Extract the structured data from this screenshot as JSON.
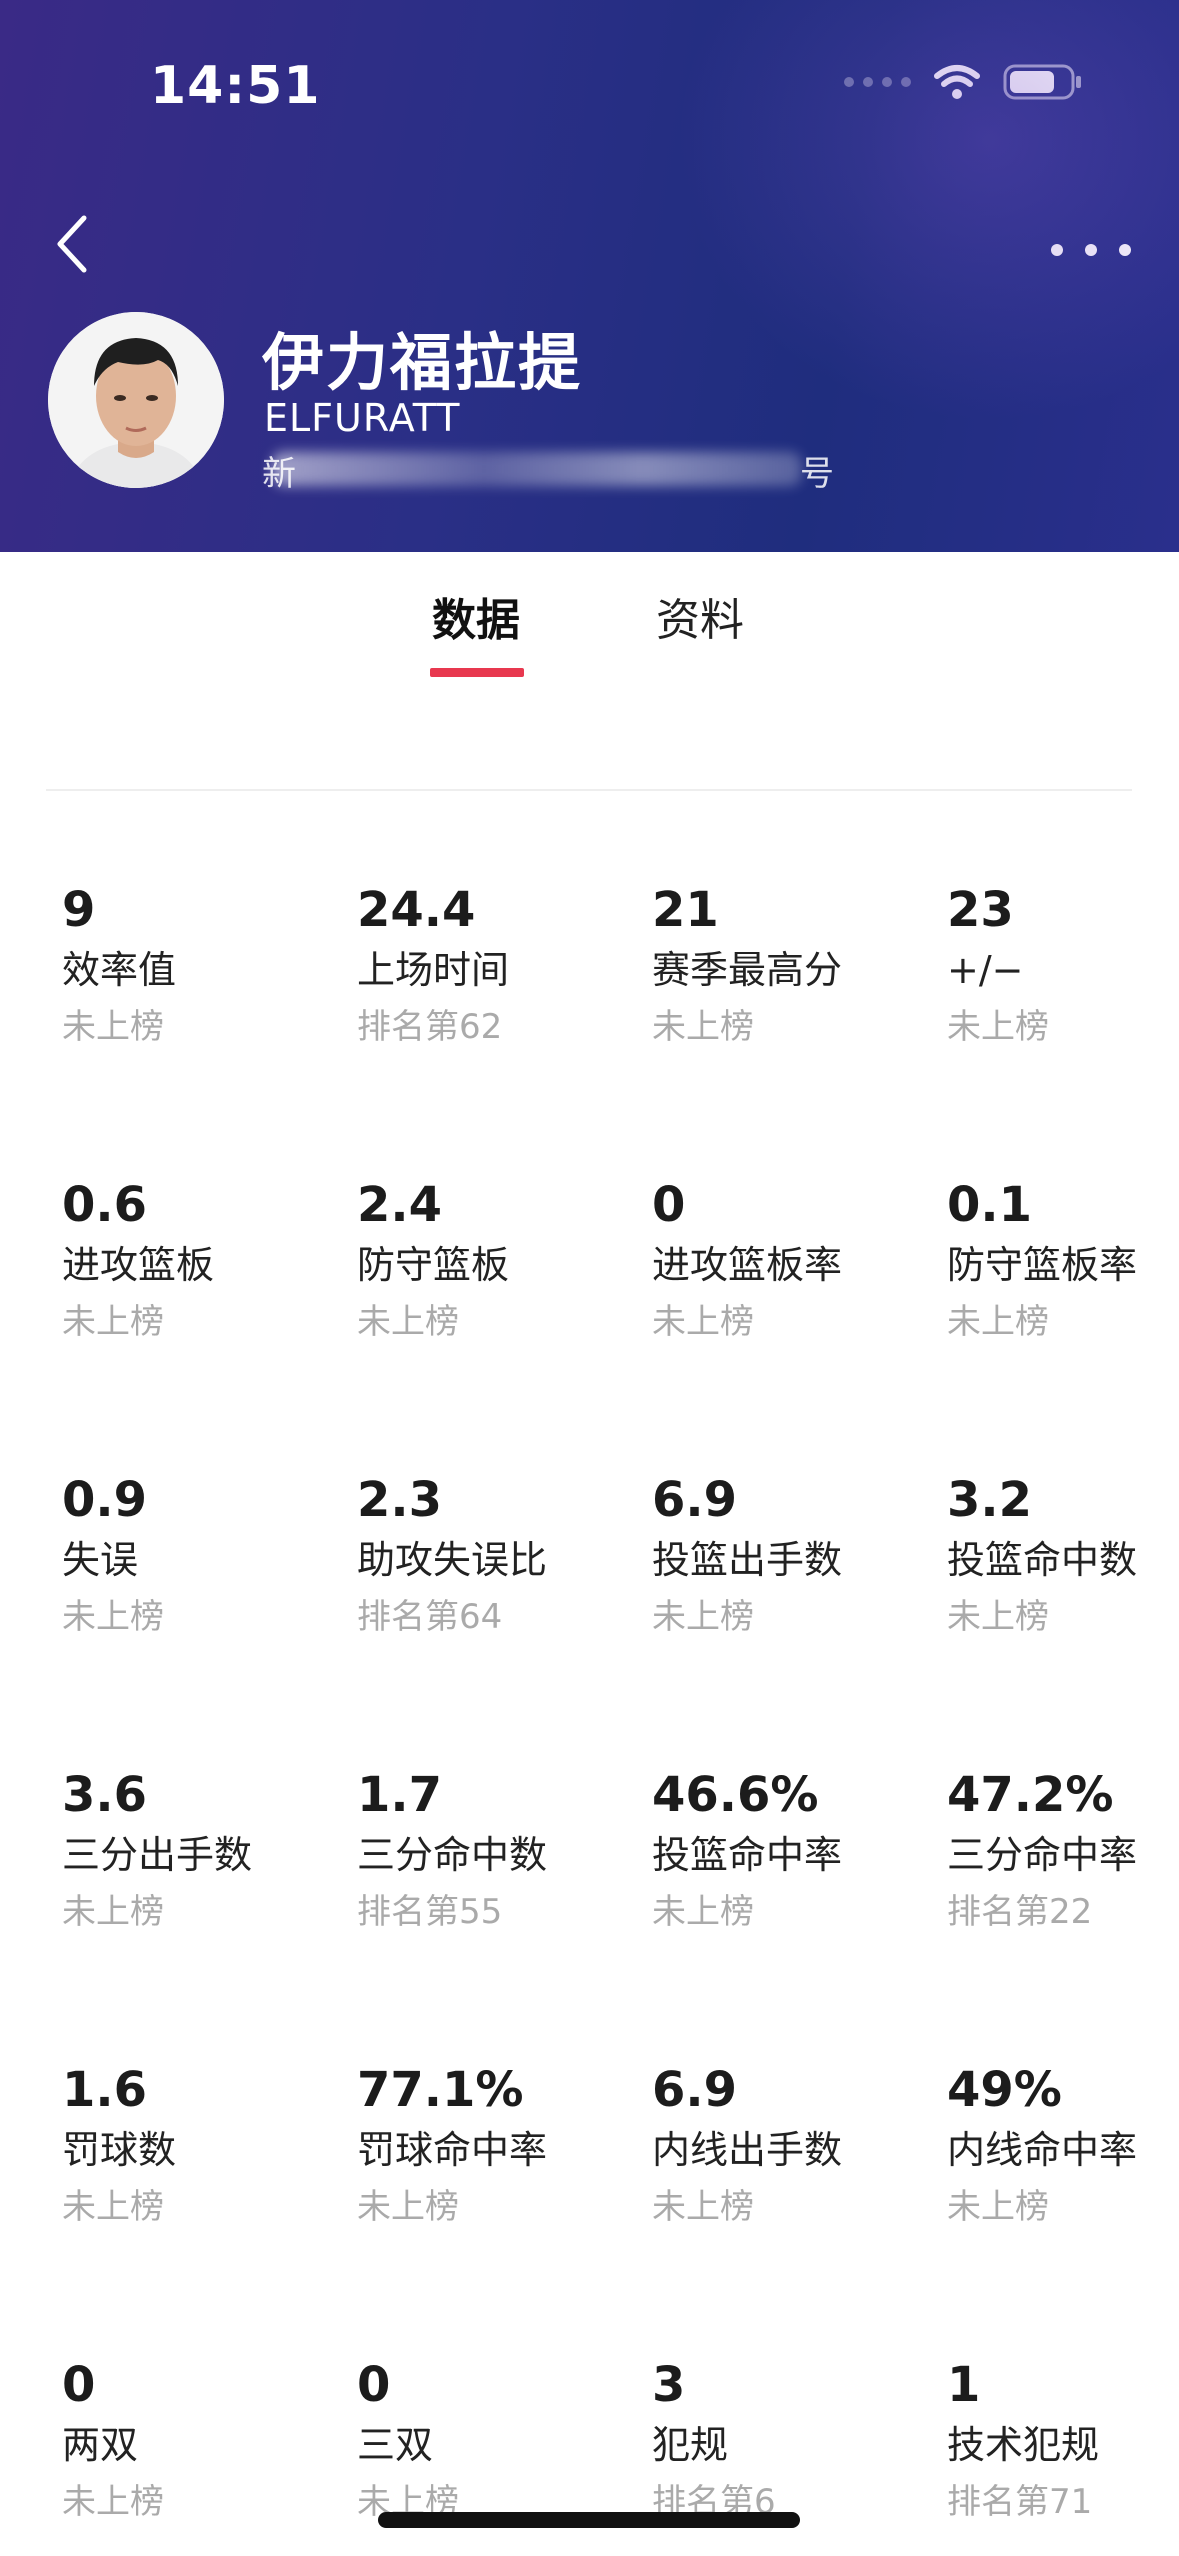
{
  "status_bar": {
    "time": "14:51"
  },
  "header": {
    "player_name": "伊力福拉提",
    "player_en": "ELFURATT",
    "sub_left": "新",
    "sub_right": "号",
    "bg_color": "#2a2f86"
  },
  "tabs": [
    {
      "label": "数据",
      "active": true
    },
    {
      "label": "资料",
      "active": false
    }
  ],
  "accent_color": "#e8384f",
  "stats": [
    {
      "value": "9",
      "label": "效率值",
      "rank": "未上榜"
    },
    {
      "value": "24.4",
      "label": "上场时间",
      "rank": "排名第62"
    },
    {
      "value": "21",
      "label": "赛季最高分",
      "rank": "未上榜"
    },
    {
      "value": "23",
      "label": "+/−",
      "rank": "未上榜"
    },
    {
      "value": "0.6",
      "label": "进攻篮板",
      "rank": "未上榜"
    },
    {
      "value": "2.4",
      "label": "防守篮板",
      "rank": "未上榜"
    },
    {
      "value": "0",
      "label": "进攻篮板率",
      "rank": "未上榜"
    },
    {
      "value": "0.1",
      "label": "防守篮板率",
      "rank": "未上榜"
    },
    {
      "value": "0.9",
      "label": "失误",
      "rank": "未上榜"
    },
    {
      "value": "2.3",
      "label": "助攻失误比",
      "rank": "排名第64"
    },
    {
      "value": "6.9",
      "label": "投篮出手数",
      "rank": "未上榜"
    },
    {
      "value": "3.2",
      "label": "投篮命中数",
      "rank": "未上榜"
    },
    {
      "value": "3.6",
      "label": "三分出手数",
      "rank": "未上榜"
    },
    {
      "value": "1.7",
      "label": "三分命中数",
      "rank": "排名第55"
    },
    {
      "value": "46.6%",
      "label": "投篮命中率",
      "rank": "未上榜"
    },
    {
      "value": "47.2%",
      "label": "三分命中率",
      "rank": "排名第22"
    },
    {
      "value": "1.6",
      "label": "罚球数",
      "rank": "未上榜"
    },
    {
      "value": "77.1%",
      "label": "罚球命中率",
      "rank": "未上榜"
    },
    {
      "value": "6.9",
      "label": "内线出手数",
      "rank": "未上榜"
    },
    {
      "value": "49%",
      "label": "内线命中率",
      "rank": "未上榜"
    },
    {
      "value": "0",
      "label": "两双",
      "rank": "未上榜"
    },
    {
      "value": "0",
      "label": "三双",
      "rank": "未上榜"
    },
    {
      "value": "3",
      "label": "犯规",
      "rank": "排名第6"
    },
    {
      "value": "1",
      "label": "技术犯规",
      "rank": "排名第71"
    }
  ]
}
